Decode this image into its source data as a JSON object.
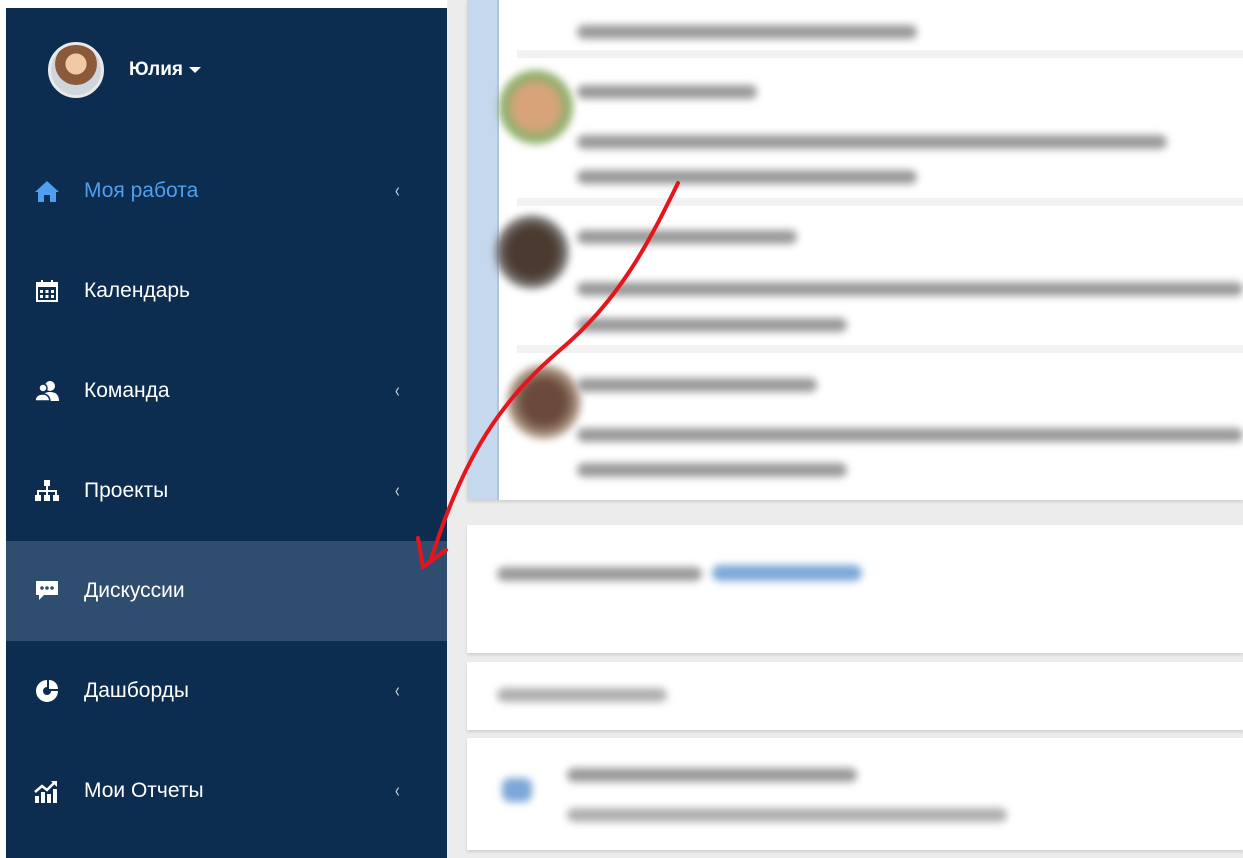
{
  "sidebar": {
    "user": {
      "name": "Юлия"
    },
    "items": [
      {
        "label": "Моя работа",
        "icon": "home-icon"
      },
      {
        "label": "Календарь",
        "icon": "calendar-icon"
      },
      {
        "label": "Команда",
        "icon": "users-icon"
      },
      {
        "label": "Проекты",
        "icon": "sitemap-icon"
      },
      {
        "label": "Дискуссии",
        "icon": "comments-icon"
      },
      {
        "label": "Дашборды",
        "icon": "pie-chart-icon"
      },
      {
        "label": "Мои Отчеты",
        "icon": "chart-growth-icon"
      }
    ],
    "chevron": "‹"
  },
  "colors": {
    "sidebar_bg": "#0c2d4f",
    "active_text": "#4e9ff0",
    "selected_bg": "#2f4e6f",
    "annotation_arrow": "#e8141b"
  }
}
